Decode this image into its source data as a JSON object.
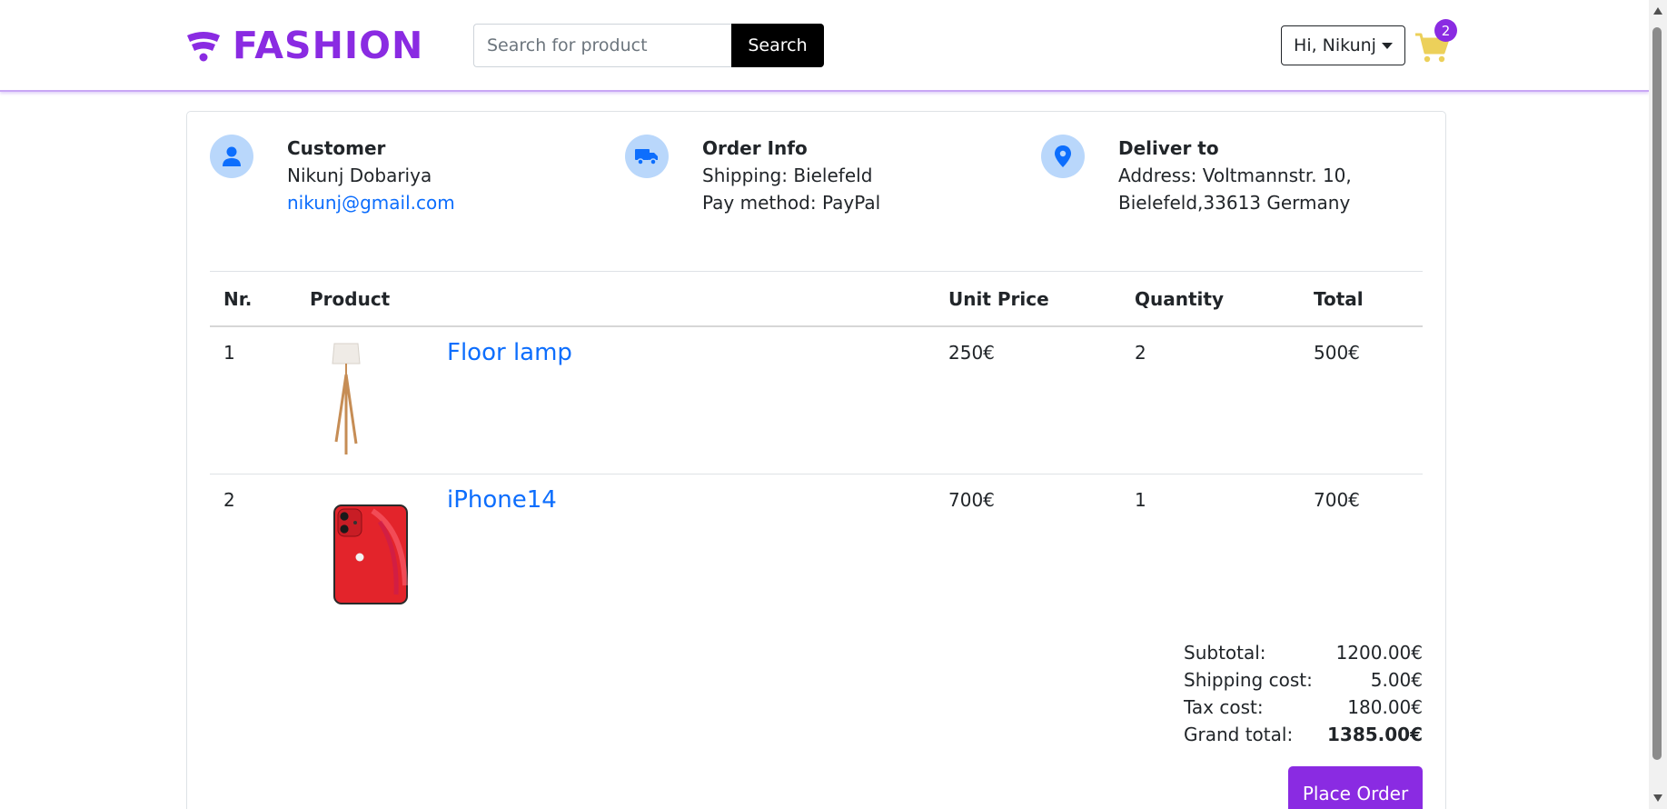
{
  "header": {
    "brand": "FASHION",
    "search": {
      "placeholder": "Search for product",
      "value": "",
      "button_label": "Search"
    },
    "user_menu_label": "Hi, Nikunj",
    "cart_count": "2",
    "accent_color": "#8a2be2"
  },
  "customer": {
    "title": "Customer",
    "name": "Nikunj Dobariya",
    "email": "nikunj@gmail.com"
  },
  "order_info": {
    "title": "Order Info",
    "shipping": "Shipping: Bielefeld",
    "pay_method": "Pay method: PayPal"
  },
  "deliver_to": {
    "title": "Deliver to",
    "address_line1": "Address: Voltmannstr. 10,",
    "address_line2": "Bielefeld,33613 Germany"
  },
  "table": {
    "headers": {
      "nr": "Nr.",
      "product": "Product",
      "unit_price": "Unit Price",
      "quantity": "Quantity",
      "total": "Total"
    },
    "rows": [
      {
        "nr": "1",
        "name": "Floor lamp",
        "unit_price": "250€",
        "quantity": "2",
        "total": "500€",
        "image": "floor-lamp"
      },
      {
        "nr": "2",
        "name": "iPhone14",
        "unit_price": "700€",
        "quantity": "1",
        "total": "700€",
        "image": "red-iphone"
      }
    ]
  },
  "totals": {
    "subtotal_label": "Subtotal:",
    "subtotal": "1200.00€",
    "shipping_label": "Shipping cost:",
    "shipping": "5.00€",
    "tax_label": "Tax cost:",
    "tax": "180.00€",
    "grand_label": "Grand total:",
    "grand": "1385.00€"
  },
  "place_order_label": "Place Order"
}
